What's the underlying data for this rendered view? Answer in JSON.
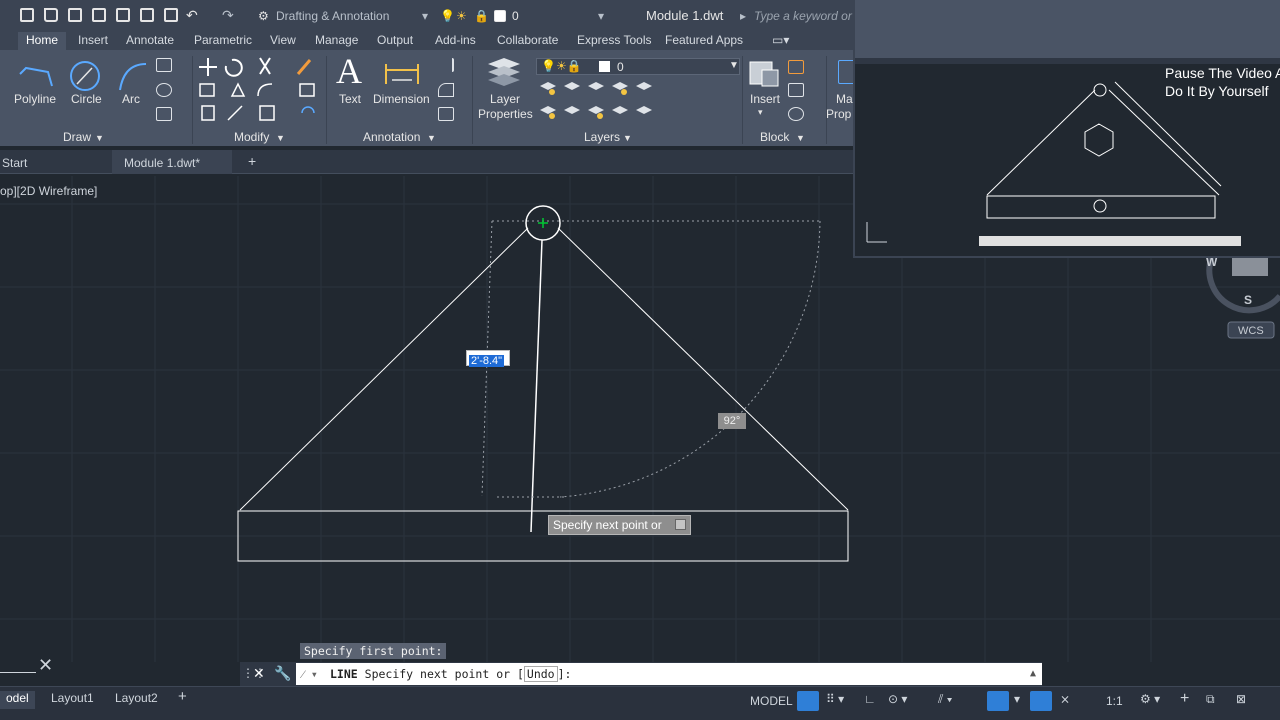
{
  "app": {
    "workspace": "Drafting & Annotation",
    "document_title": "Module 1.dwt",
    "search_placeholder": "Type a keyword or ph",
    "layer_current": "0"
  },
  "ribbon_tabs": [
    "Home",
    "Insert",
    "Annotate",
    "Parametric",
    "View",
    "Manage",
    "Output",
    "Add-ins",
    "Collaborate",
    "Express Tools",
    "Featured Apps"
  ],
  "ribbon": {
    "draw": {
      "polyline": "Polyline",
      "circle": "Circle",
      "arc": "Arc",
      "panel": "Draw"
    },
    "modify": {
      "panel": "Modify"
    },
    "annotation": {
      "text": "Text",
      "dimension": "Dimension",
      "panel": "Annotation"
    },
    "layers": {
      "layer_properties_line1": "Layer",
      "layer_properties_line2": "Properties",
      "layer_value": "0",
      "panel": "Layers"
    },
    "block": {
      "insert": "Insert",
      "panel": "Block",
      "match_prop_line1": "Ma",
      "match_prop_line2": "Prop"
    }
  },
  "doc_tabs": {
    "start": "Start",
    "module": "Module 1.dwt*"
  },
  "viewport": {
    "label": "op][2D Wireframe]",
    "dim_input": "2'-8.4\"",
    "angle": "92°",
    "tooltip": "Specify next point or"
  },
  "command": {
    "history": "Specify first point:",
    "prompt_cmd": "LINE",
    "prompt_text": "Specify next point or [",
    "prompt_option": "Undo",
    "prompt_end": "]:"
  },
  "status": {
    "layout_tabs": [
      "odel",
      "Layout1",
      "Layout2"
    ],
    "model": "MODEL",
    "scale": "1:1"
  },
  "overlay": {
    "line1": "Pause The Video A",
    "line2": "Do It By Yourself",
    "navcube_s": "S",
    "navcube_w": "W",
    "wcs": "WCS"
  },
  "colors": {
    "canvas": "#212830",
    "ribbon": "#4a5465",
    "accent": "#2f7fd7",
    "grip": "#00c832"
  }
}
